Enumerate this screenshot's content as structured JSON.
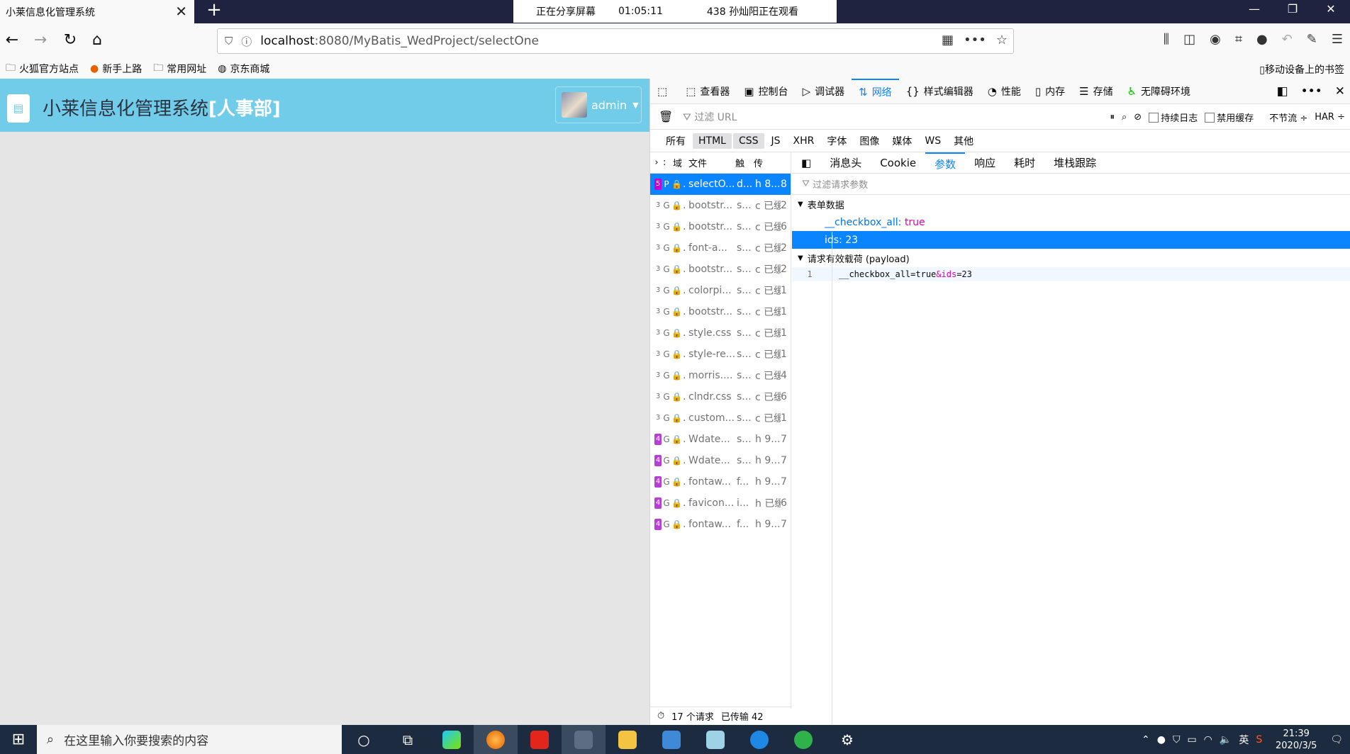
{
  "browser": {
    "tab_title": "小莱信息化管理系统",
    "share_status": "正在分享屏幕",
    "share_time": "01:05:11",
    "viewers": "438 孙灿阳正在观看",
    "url_host": "localhost",
    "url_path": ":8080/MyBatis_WedProject/selectOne",
    "bookmarks": [
      "火狐官方站点",
      "新手上路",
      "常用网址",
      "京东商城"
    ],
    "mobile_bookmarks": "移动设备上的书签"
  },
  "app": {
    "title": "小莱信息化管理系统",
    "department": "[人事部]",
    "user": "admin"
  },
  "devtools": {
    "tabs": [
      "查看器",
      "控制台",
      "调试器",
      "网络",
      "样式编辑器",
      "性能",
      "内存",
      "存储",
      "无障碍环境"
    ],
    "filter_url_placeholder": "过滤 URL",
    "persist_logs": "持续日志",
    "disable_cache": "禁用缓存",
    "throttle": "不节流 ÷",
    "har": "HAR ÷",
    "type_filters": [
      "所有",
      "HTML",
      "CSS",
      "JS",
      "XHR",
      "字体",
      "图像",
      "媒体",
      "WS",
      "其他"
    ],
    "columns": [
      "域",
      "文件",
      "触",
      "传"
    ],
    "requests": [
      {
        "status": "5",
        "method": "P",
        "file": "selectO...",
        "type": "d...",
        "transfer": "h 8...",
        "size": "8"
      },
      {
        "status": "3",
        "method": "G",
        "file": "bootstr...",
        "type": "s...",
        "transfer": "c 已缓",
        "size": "2"
      },
      {
        "status": "3",
        "method": "G",
        "file": "bootstr...",
        "type": "s...",
        "transfer": "c 已缓",
        "size": "6"
      },
      {
        "status": "3",
        "method": "G",
        "file": "font-a...",
        "type": "s...",
        "transfer": "c 已缓",
        "size": "2"
      },
      {
        "status": "3",
        "method": "G",
        "file": "bootstr...",
        "type": "s...",
        "transfer": "c 已缓",
        "size": "2"
      },
      {
        "status": "3",
        "method": "G",
        "file": "colorpi...",
        "type": "s...",
        "transfer": "c 已缓",
        "size": "1"
      },
      {
        "status": "3",
        "method": "G",
        "file": "bootstr...",
        "type": "s...",
        "transfer": "c 已缓",
        "size": "1"
      },
      {
        "status": "3",
        "method": "G",
        "file": "style.css",
        "type": "s...",
        "transfer": "c 已缓",
        "size": "1"
      },
      {
        "status": "3",
        "method": "G",
        "file": "style-re...",
        "type": "s...",
        "transfer": "c 已缓",
        "size": "1"
      },
      {
        "status": "3",
        "method": "G",
        "file": "morris....",
        "type": "s...",
        "transfer": "c 已缓",
        "size": "4"
      },
      {
        "status": "3",
        "method": "G",
        "file": "clndr.css",
        "type": "s...",
        "transfer": "c 已缓",
        "size": "6"
      },
      {
        "status": "3",
        "method": "G",
        "file": "custom...",
        "type": "s...",
        "transfer": "c 已缓",
        "size": "1"
      },
      {
        "status": "4",
        "method": "G",
        "file": "Wdate...",
        "type": "s...",
        "transfer": "h 9...",
        "size": "7"
      },
      {
        "status": "4",
        "method": "G",
        "file": "Wdate...",
        "type": "s...",
        "transfer": "h 9...",
        "size": "7"
      },
      {
        "status": "4",
        "method": "G",
        "file": "fontaw...",
        "type": "f...",
        "transfer": "h 9...",
        "size": "7"
      },
      {
        "status": "4",
        "method": "G",
        "file": "favicon...",
        "type": "i...",
        "transfer": "h 已缓",
        "size": "6"
      },
      {
        "status": "4",
        "method": "G",
        "file": "fontaw...",
        "type": "f...",
        "transfer": "h 9...",
        "size": "7"
      }
    ],
    "request_count": "17 个请求",
    "transferred": "已传输 42",
    "detail_tabs": [
      "消息头",
      "Cookie",
      "参数",
      "响应",
      "耗时",
      "堆栈跟踪"
    ],
    "param_filter_placeholder": "过滤请求参数",
    "form_data_label": "表单数据",
    "form_data": [
      {
        "key": "__checkbox_all",
        "value": "true"
      },
      {
        "key": "ids",
        "value": "23"
      }
    ],
    "payload_label": "请求有效载荷 (payload)",
    "payload_line_no": "1",
    "payload_part1": "__checkbox_all=true",
    "payload_part2": "&ids",
    "payload_part3": "=23"
  },
  "taskbar": {
    "search_placeholder": "在这里输入你要搜索的内容",
    "ime": "英",
    "time": "21:39",
    "date": "2020/3/5"
  }
}
